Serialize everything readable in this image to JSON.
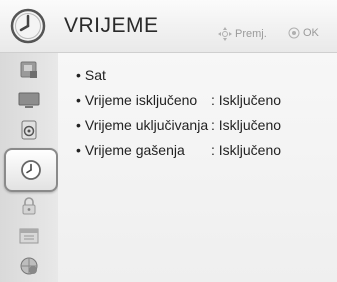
{
  "header": {
    "title": "VRIJEME",
    "hint_move": "Premj.",
    "hint_ok": "OK"
  },
  "sidebar": {
    "items": [
      {
        "icon": "picture-icon"
      },
      {
        "icon": "screen-icon"
      },
      {
        "icon": "speaker-icon"
      },
      {
        "icon": "clock-icon",
        "selected": true
      },
      {
        "icon": "lock-icon"
      },
      {
        "icon": "calendar-icon"
      },
      {
        "icon": "network-icon"
      }
    ]
  },
  "menu": {
    "items": [
      {
        "label": "Sat",
        "value": ""
      },
      {
        "label": "Vrijeme isključeno",
        "value": ": Isključeno"
      },
      {
        "label": "Vrijeme uključivanja",
        "value": ": Isključeno"
      },
      {
        "label": "Vrijeme gašenja",
        "value": ": Isključeno"
      }
    ]
  }
}
